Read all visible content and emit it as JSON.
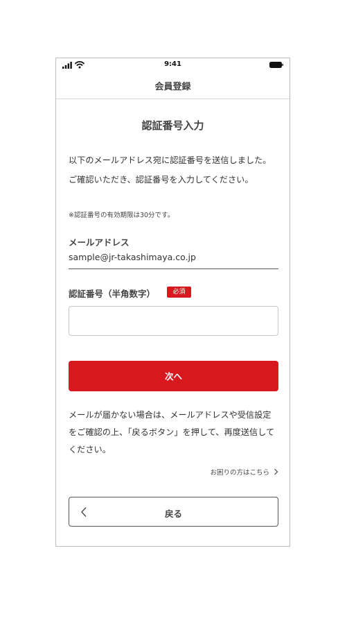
{
  "status_bar": {
    "time": "9:41",
    "icons": [
      "signal-icon",
      "wifi-icon",
      "battery-icon"
    ]
  },
  "header": {
    "title": "会員登録"
  },
  "main": {
    "title": "認証番号入力",
    "intro_text": "以下のメールアドレス宛に認証番号を送信しました。ご確認いただき、認証番号を入力してください。",
    "validity_note": "※認証番号の有効期限は30分です。",
    "email": {
      "label": "メールアドレス",
      "value": "sample@jr-takashimaya.co.jp"
    },
    "code_field": {
      "label": "認証番号（半角数字）",
      "required_badge": "必須",
      "value": "",
      "placeholder": ""
    },
    "next_button_label": "次へ",
    "help_text": "メールが届かない場合は、メールアドレスや受信設定をご確認の上、「戻るボタン」を押して、再度送信してください。",
    "trouble_link_label": "お困りの方はこちら",
    "back_button_label": "戻る"
  },
  "colors": {
    "accent": "#d7191f",
    "text": "#333333",
    "border": "#c7c7c7"
  }
}
